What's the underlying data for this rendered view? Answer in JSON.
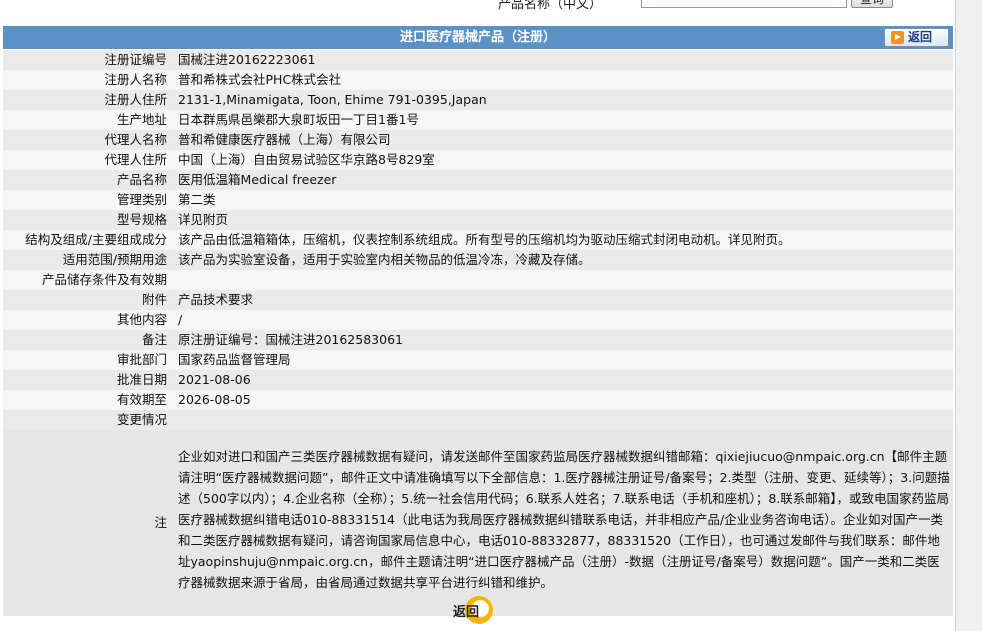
{
  "search": {
    "label": "产品名称（中文）",
    "button": "查询"
  },
  "header": {
    "title": "进口医疗器械产品（注册）",
    "back_label": "返回"
  },
  "rows": [
    {
      "label": "注册证编号",
      "value": "国械注进20162223061"
    },
    {
      "label": "注册人名称",
      "value": "普和希株式会社PHC株式会社"
    },
    {
      "label": "注册人住所",
      "value": "2131-1,Minamigata, Toon, Ehime 791-0395,Japan"
    },
    {
      "label": "生产地址",
      "value": "日本群馬県邑樂郡大泉町坂田一丁目1番1号"
    },
    {
      "label": "代理人名称",
      "value": "普和希健康医疗器械（上海）有限公司"
    },
    {
      "label": "代理人住所",
      "value": "中国（上海）自由贸易试验区华京路8号829室"
    },
    {
      "label": "产品名称",
      "value": "医用低温箱Medical freezer"
    },
    {
      "label": "管理类别",
      "value": "第二类"
    },
    {
      "label": "型号规格",
      "value": "详见附页"
    },
    {
      "label": "结构及组成/主要组成成分",
      "value": "该产品由低温箱箱体，压缩机，仪表控制系统组成。所有型号的压缩机均为驱动压缩式封闭电动机。详见附页。"
    },
    {
      "label": "适用范围/预期用途",
      "value": "该产品为实验室设备，适用于实验室内相关物品的低温冷冻，冷藏及存储。"
    },
    {
      "label": "产品储存条件及有效期",
      "value": ""
    },
    {
      "label": "附件",
      "value": "产品技术要求"
    },
    {
      "label": "其他内容",
      "value": "/"
    },
    {
      "label": "备注",
      "value": "原注册证编号：国械注进20162583061"
    },
    {
      "label": "审批部门",
      "value": "国家药品监督管理局"
    },
    {
      "label": "批准日期",
      "value": "2021-08-06"
    },
    {
      "label": "有效期至",
      "value": "2026-08-05"
    },
    {
      "label": "变更情况",
      "value": ""
    }
  ],
  "note": {
    "label": "注",
    "text": "企业如对进口和国产三类医疗器械数据有疑问，请发送邮件至国家药监局医疗器械数据纠错邮箱：qixiejiucuo@nmpaic.org.cn【邮件主题请注明“医疗器械数据问题”，邮件正文中请准确填写以下全部信息：1.医疗器械注册证号/备案号；2.类型（注册、变更、延续等）；3.问题描述（500字以内）；4.企业名称（全称）；5.统一社会信用代码；6.联系人姓名；7.联系电话（手机和座机）；8.联系邮箱】，或致电国家药监局医疗器械数据纠错电话010-88331514（此电话为我局医疗器械数据纠错联系电话，并非相应产品/企业业务咨询电话）。企业如对国产一类和二类医疗器械数据有疑问，请咨询国家局信息中心，电话010-88332877，88331520（工作日），也可通过发邮件与我们联系：邮件地址yaopinshuju@nmpaic.org.cn，邮件主题请注明“进口医疗器械产品（注册）-数据（注册证号/备案号）数据问题”。国产一类和二类医疗器械数据来源于省局，由省局通过数据共享平台进行纠错和维护。"
  },
  "footer": {
    "back_label": "返回"
  },
  "colors": {
    "header_bg": "#5b92c6",
    "row_odd": "#eaeaea",
    "row_even": "#f6f6f6",
    "back_icon": "#f0961e",
    "bottom_ring": "#f6b500"
  }
}
